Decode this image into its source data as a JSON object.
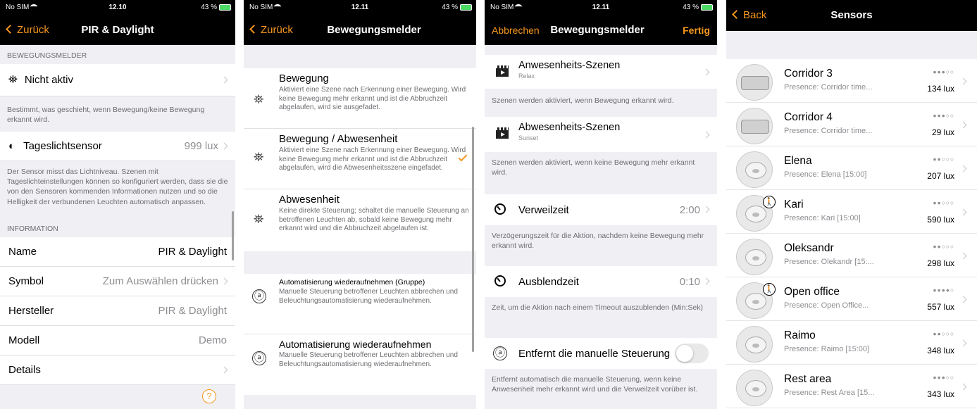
{
  "screen1": {
    "status": {
      "carrier": "No SIM",
      "time": "12.10",
      "battery": "43 %"
    },
    "nav": {
      "back": "Zurück",
      "title": "PIR & Daylight"
    },
    "motion_header": "BEWEGUNGSMELDER",
    "motion_row": {
      "label": "Nicht aktiv"
    },
    "motion_footer": "Bestimmt, was geschieht, wenn Bewegung/keine Bewegung erkannt wird.",
    "daylight_row": {
      "label": "Tageslichtsensor",
      "value": "999 lux"
    },
    "daylight_footer": "Der Sensor misst das Lichtniveau. Szenen mit Tageslichteinstellungen können so konfiguriert werden, dass sie die von den Sensoren kommenden Informationen nutzen und so die Helligkeit der verbundenen Leuchten automatisch anpassen.",
    "info_header": "INFORMATION",
    "info_rows": [
      {
        "label": "Name",
        "value": "PIR & Daylight"
      },
      {
        "label": "Symbol",
        "value": "Zum Auswählen drücken"
      },
      {
        "label": "Hersteller",
        "value": "PIR & Daylight"
      },
      {
        "label": "Modell",
        "value": "Demo"
      },
      {
        "label": "Details",
        "value": ""
      }
    ],
    "help": "?"
  },
  "screen2": {
    "status": {
      "carrier": "No SIM",
      "time": "12.11",
      "battery": "43 %"
    },
    "nav": {
      "back": "Zurück",
      "title": "Bewegungsmelder"
    },
    "options": [
      {
        "title": "Bewegung",
        "desc": "Aktiviert eine Szene nach Erkennung einer Bewegung. Wird keine Bewegung mehr erkannt und ist die Abbruchzeit abgelaufen, wird sie ausgefadet."
      },
      {
        "title": "Bewegung / Abwesenheit",
        "desc": "Aktiviert eine Szene nach Erkennung einer Bewegung. Wird keine Bewegung mehr erkannt und ist die Abbruchzeit abgelaufen, wird die Abwesenheitsszene eingefadet."
      },
      {
        "title": "Abwesenheit",
        "desc": "Keine direkte Steuerung; schaltet die manuelle Steuerung an betroffenen Leuchten ab, sobald keine Bewegung mehr erkannt wird und die Abbruchzeit abgelaufen ist."
      }
    ],
    "auto_options": [
      {
        "title": "Automatisierung wiederaufnehmen (Gruppe)",
        "desc": "Manuelle Steuerung betroffener Leuchten abbrechen und Beleuchtungsautomatisierung wiederaufnehmen."
      },
      {
        "title": "Automatisierung wiederaufnehmen",
        "desc": "Manuelle Steuerung betroffener Leuchten abbrechen und Beleuchtungsautomatisierung wiederaufnehmen."
      }
    ],
    "glyph_a": "ⓐ"
  },
  "screen3": {
    "status": {
      "carrier": "No SIM",
      "time": "12.11",
      "battery": "43 %"
    },
    "nav": {
      "cancel": "Abbrechen",
      "title": "Bewegungsmelder",
      "done": "Fertig"
    },
    "presence": {
      "title": "Anwesenheits-Szenen",
      "sub": "Relax",
      "footer": "Szenen werden aktiviert, wenn Bewegung erkannt wird."
    },
    "absence": {
      "title": "Abwesenheits-Szenen",
      "sub": "Sunset",
      "footer": "Szenen werden aktiviert, wenn keine Bewegung mehr erkannt wird."
    },
    "hold": {
      "label": "Verweilzeit",
      "value": "2:00",
      "footer": "Verzögerungszeit für die Aktion, nachdem keine Bewegung mehr erkannt wird."
    },
    "fade": {
      "label": "Ausblendzeit",
      "value": "0:10",
      "footer": "Zeit, um die Aktion nach einem Timeout auszublenden (Min:Sek)"
    },
    "manual": {
      "label": "Entfernt die manuelle Steuerung",
      "footer": "Entfernt automatisch die manuelle Steuerung, wenn keine Anwesenheit mehr erkannt wird und die Verweilzeit vorüber ist."
    },
    "glyph_a": "ⓐ"
  },
  "screen4": {
    "nav": {
      "back": "Back",
      "title": "Sensors"
    },
    "sensors": [
      {
        "name": "Corridor 3",
        "sub": "Presence: Corridor time...",
        "signal": "●●●○○",
        "lux": "134 lux",
        "type": "cyl",
        "walker": false
      },
      {
        "name": "Corridor 4",
        "sub": "Presence: Corridor time...",
        "signal": "●●●○○",
        "lux": "29 lux",
        "type": "cyl",
        "walker": false
      },
      {
        "name": "Elena",
        "sub": "Presence: Elena [15:00]",
        "signal": "●●○○○",
        "lux": "207 lux",
        "type": "disc",
        "walker": false
      },
      {
        "name": "Kari",
        "sub": "Presence: Kari [15:00]",
        "signal": "●●○○○",
        "lux": "590 lux",
        "type": "disc",
        "walker": true
      },
      {
        "name": "Oleksandr",
        "sub": "Presence: Olekandr [15:...",
        "signal": "●●○○○",
        "lux": "298 lux",
        "type": "disc",
        "walker": false
      },
      {
        "name": "Open office",
        "sub": "Presence: Open Office...",
        "signal": "●●●●○",
        "lux": "557 lux",
        "type": "disc",
        "walker": true
      },
      {
        "name": "Raimo",
        "sub": "Presence: Raimo [15:00]",
        "signal": "●●○○○",
        "lux": "348 lux",
        "type": "disc",
        "walker": false
      },
      {
        "name": "Rest area",
        "sub": "Presence: Rest Area [15...",
        "signal": "●●●○○",
        "lux": "343 lux",
        "type": "disc",
        "walker": false
      }
    ]
  },
  "colors": {
    "accent": "#f5961e",
    "bar": "#000000",
    "grouped_bg": "#efeff4"
  }
}
